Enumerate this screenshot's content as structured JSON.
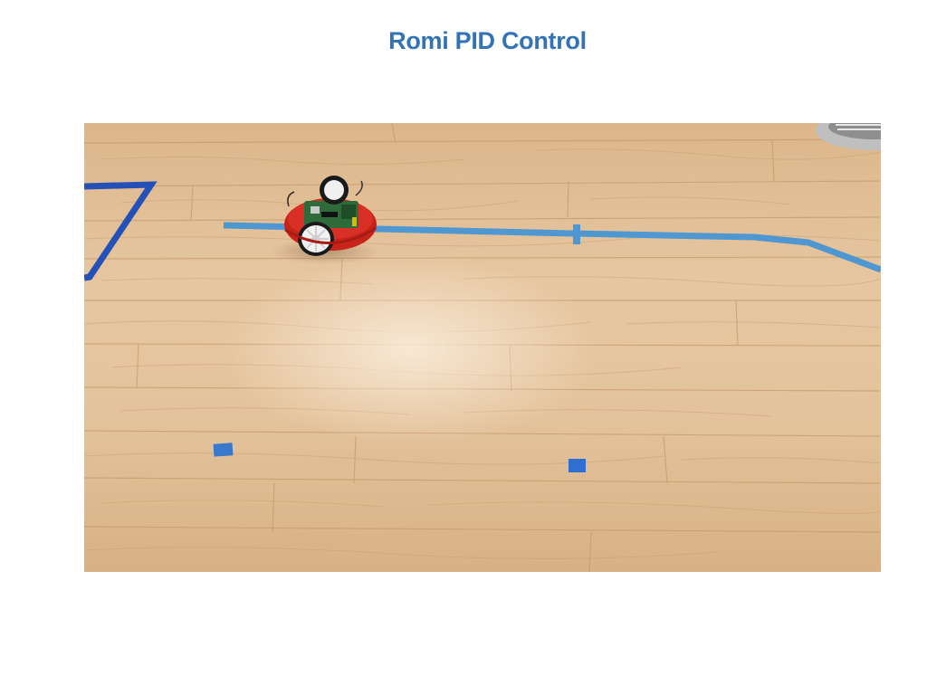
{
  "slide": {
    "title": "Romi PID Control"
  },
  "photo": {
    "subject": "robot-on-floor",
    "colors": {
      "floor_light": "#e7c9a3",
      "floor_mid": "#d9b287",
      "floor_dark": "#c89a6c",
      "tape_light_blue": "#4e97d1",
      "tape_dark_blue": "#2550b8",
      "robot_red": "#c8231b",
      "robot_pcb": "#2f6b3a",
      "wheel_white": "#f2f2f2"
    }
  },
  "theme": {
    "title_color": "#3373b5",
    "background": "#ffffff"
  }
}
